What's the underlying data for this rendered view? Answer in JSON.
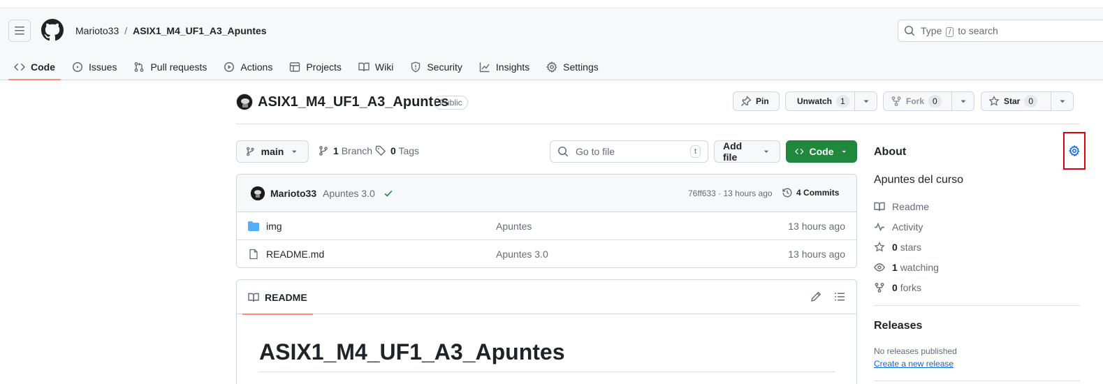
{
  "header": {
    "owner": "Marioto33",
    "separator": "/",
    "repo": "ASIX1_M4_UF1_A3_Apuntes",
    "search": {
      "prefix": "Type",
      "key": "/",
      "suffix": "to search"
    }
  },
  "tabs": [
    {
      "label": "Code",
      "icon": "code-icon",
      "active": true
    },
    {
      "label": "Issues",
      "icon": "issue-icon"
    },
    {
      "label": "Pull requests",
      "icon": "pull-request-icon"
    },
    {
      "label": "Actions",
      "icon": "play-icon"
    },
    {
      "label": "Projects",
      "icon": "table-icon"
    },
    {
      "label": "Wiki",
      "icon": "book-icon"
    },
    {
      "label": "Security",
      "icon": "shield-icon"
    },
    {
      "label": "Insights",
      "icon": "graph-icon"
    },
    {
      "label": "Settings",
      "icon": "gear-icon"
    }
  ],
  "repo_header": {
    "title": "ASIX1_M4_UF1_A3_Apuntes",
    "visibility": "Public",
    "pin_label": "Pin",
    "unwatch_label": "Unwatch",
    "watch_count": "1",
    "fork_label": "Fork",
    "fork_count": "0",
    "star_label": "Star",
    "star_count": "0"
  },
  "toolbar": {
    "branch": "main",
    "branches_count": "1",
    "branches_label": "Branch",
    "tags_count": "0",
    "tags_label": "Tags",
    "goto_placeholder": "Go to file",
    "goto_key": "t",
    "add_file_label": "Add file",
    "code_label": "Code"
  },
  "commit": {
    "author": "Marioto33",
    "message": "Apuntes 3.0",
    "meta": "76ff633 · 13 hours ago",
    "commits_count": "4",
    "commits_label": "Commits"
  },
  "files": [
    {
      "name": "img",
      "type": "folder",
      "message": "Apuntes",
      "date": "13 hours ago"
    },
    {
      "name": "README.md",
      "type": "file",
      "message": "Apuntes 3.0",
      "date": "13 hours ago"
    }
  ],
  "readme": {
    "tab_label": "README",
    "heading": "ASIX1_M4_UF1_A3_Apuntes"
  },
  "about": {
    "title": "About",
    "description": "Apuntes del curso",
    "readme_label": "Readme",
    "activity_label": "Activity",
    "stars_count": "0",
    "stars_label": "stars",
    "watching_count": "1",
    "watching_label": "watching",
    "forks_count": "0",
    "forks_label": "forks"
  },
  "releases": {
    "title": "Releases",
    "none_text": "No releases published",
    "create_link": "Create a new release"
  },
  "colors": {
    "accent_blue": "#0969da",
    "primary_green": "#1f883d",
    "tab_underline": "#fd8c73",
    "highlight_red": "#e0000f"
  }
}
